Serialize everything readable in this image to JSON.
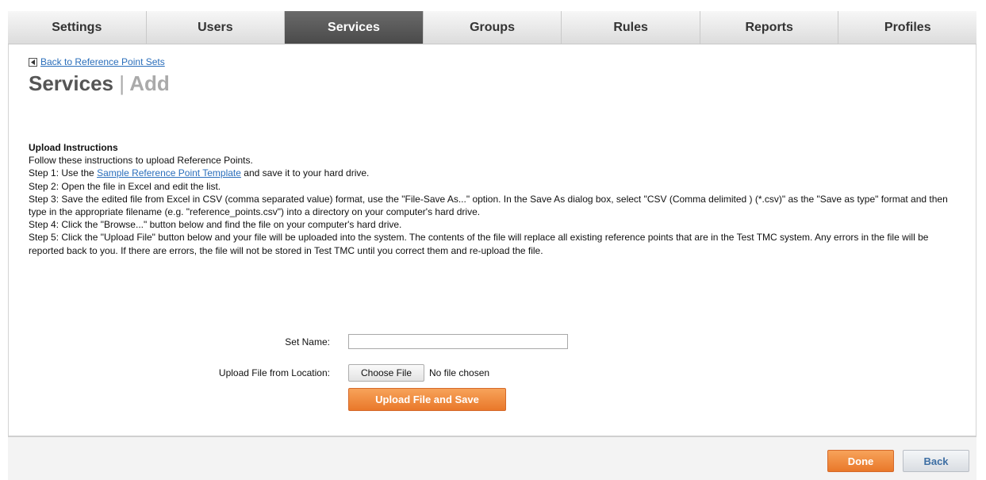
{
  "tabs": [
    {
      "label": "Settings",
      "active": false
    },
    {
      "label": "Users",
      "active": false
    },
    {
      "label": "Services",
      "active": true
    },
    {
      "label": "Groups",
      "active": false
    },
    {
      "label": "Rules",
      "active": false
    },
    {
      "label": "Reports",
      "active": false
    },
    {
      "label": "Profiles",
      "active": false
    }
  ],
  "breadcrumb": {
    "back_label": "Back to Reference Point Sets",
    "icon": "back-arrow-icon"
  },
  "page_title": {
    "main": "Services",
    "separator": "|",
    "sub": "Add"
  },
  "instructions": {
    "heading": "Upload Instructions",
    "intro": "Follow these instructions to upload Reference Points.",
    "step1_prefix": "Step 1: Use the ",
    "step1_link": "Sample Reference Point Template",
    "step1_suffix": " and save it to your hard drive.",
    "step2": "Step 2: Open the file in Excel and edit the list.",
    "step3": "Step 3: Save the edited file from Excel in CSV (comma separated value) format, use the \"File-Save As...\" option. In the Save As dialog box, select \"CSV (Comma delimited ) (*.csv)\" as the \"Save as type\" format and then type in the appropriate filename (e.g. \"reference_points.csv\") into a directory on your computer's hard drive.",
    "step4": "Step 4: Click the \"Browse...\" button below and find the file on your computer's hard drive.",
    "step5": "Step 5: Click the \"Upload File\" button below and your file will be uploaded into the system. The contents of the file will replace all existing reference points that are in the Test TMC system. Any errors in the file will be reported back to you. If there are errors, the file will not be stored in Test TMC until you correct them and re-upload the file."
  },
  "form": {
    "set_name_label": "Set Name:",
    "set_name_value": "",
    "upload_label": "Upload File from Location:",
    "choose_file_label": "Choose File",
    "no_file_text": "No file chosen",
    "upload_button_label": "Upload File and Save"
  },
  "footer": {
    "done_label": "Done",
    "back_label": "Back"
  },
  "colors": {
    "accent_orange": "#e9782a",
    "active_tab": "#4a4a4a",
    "link": "#2a6ebb"
  }
}
